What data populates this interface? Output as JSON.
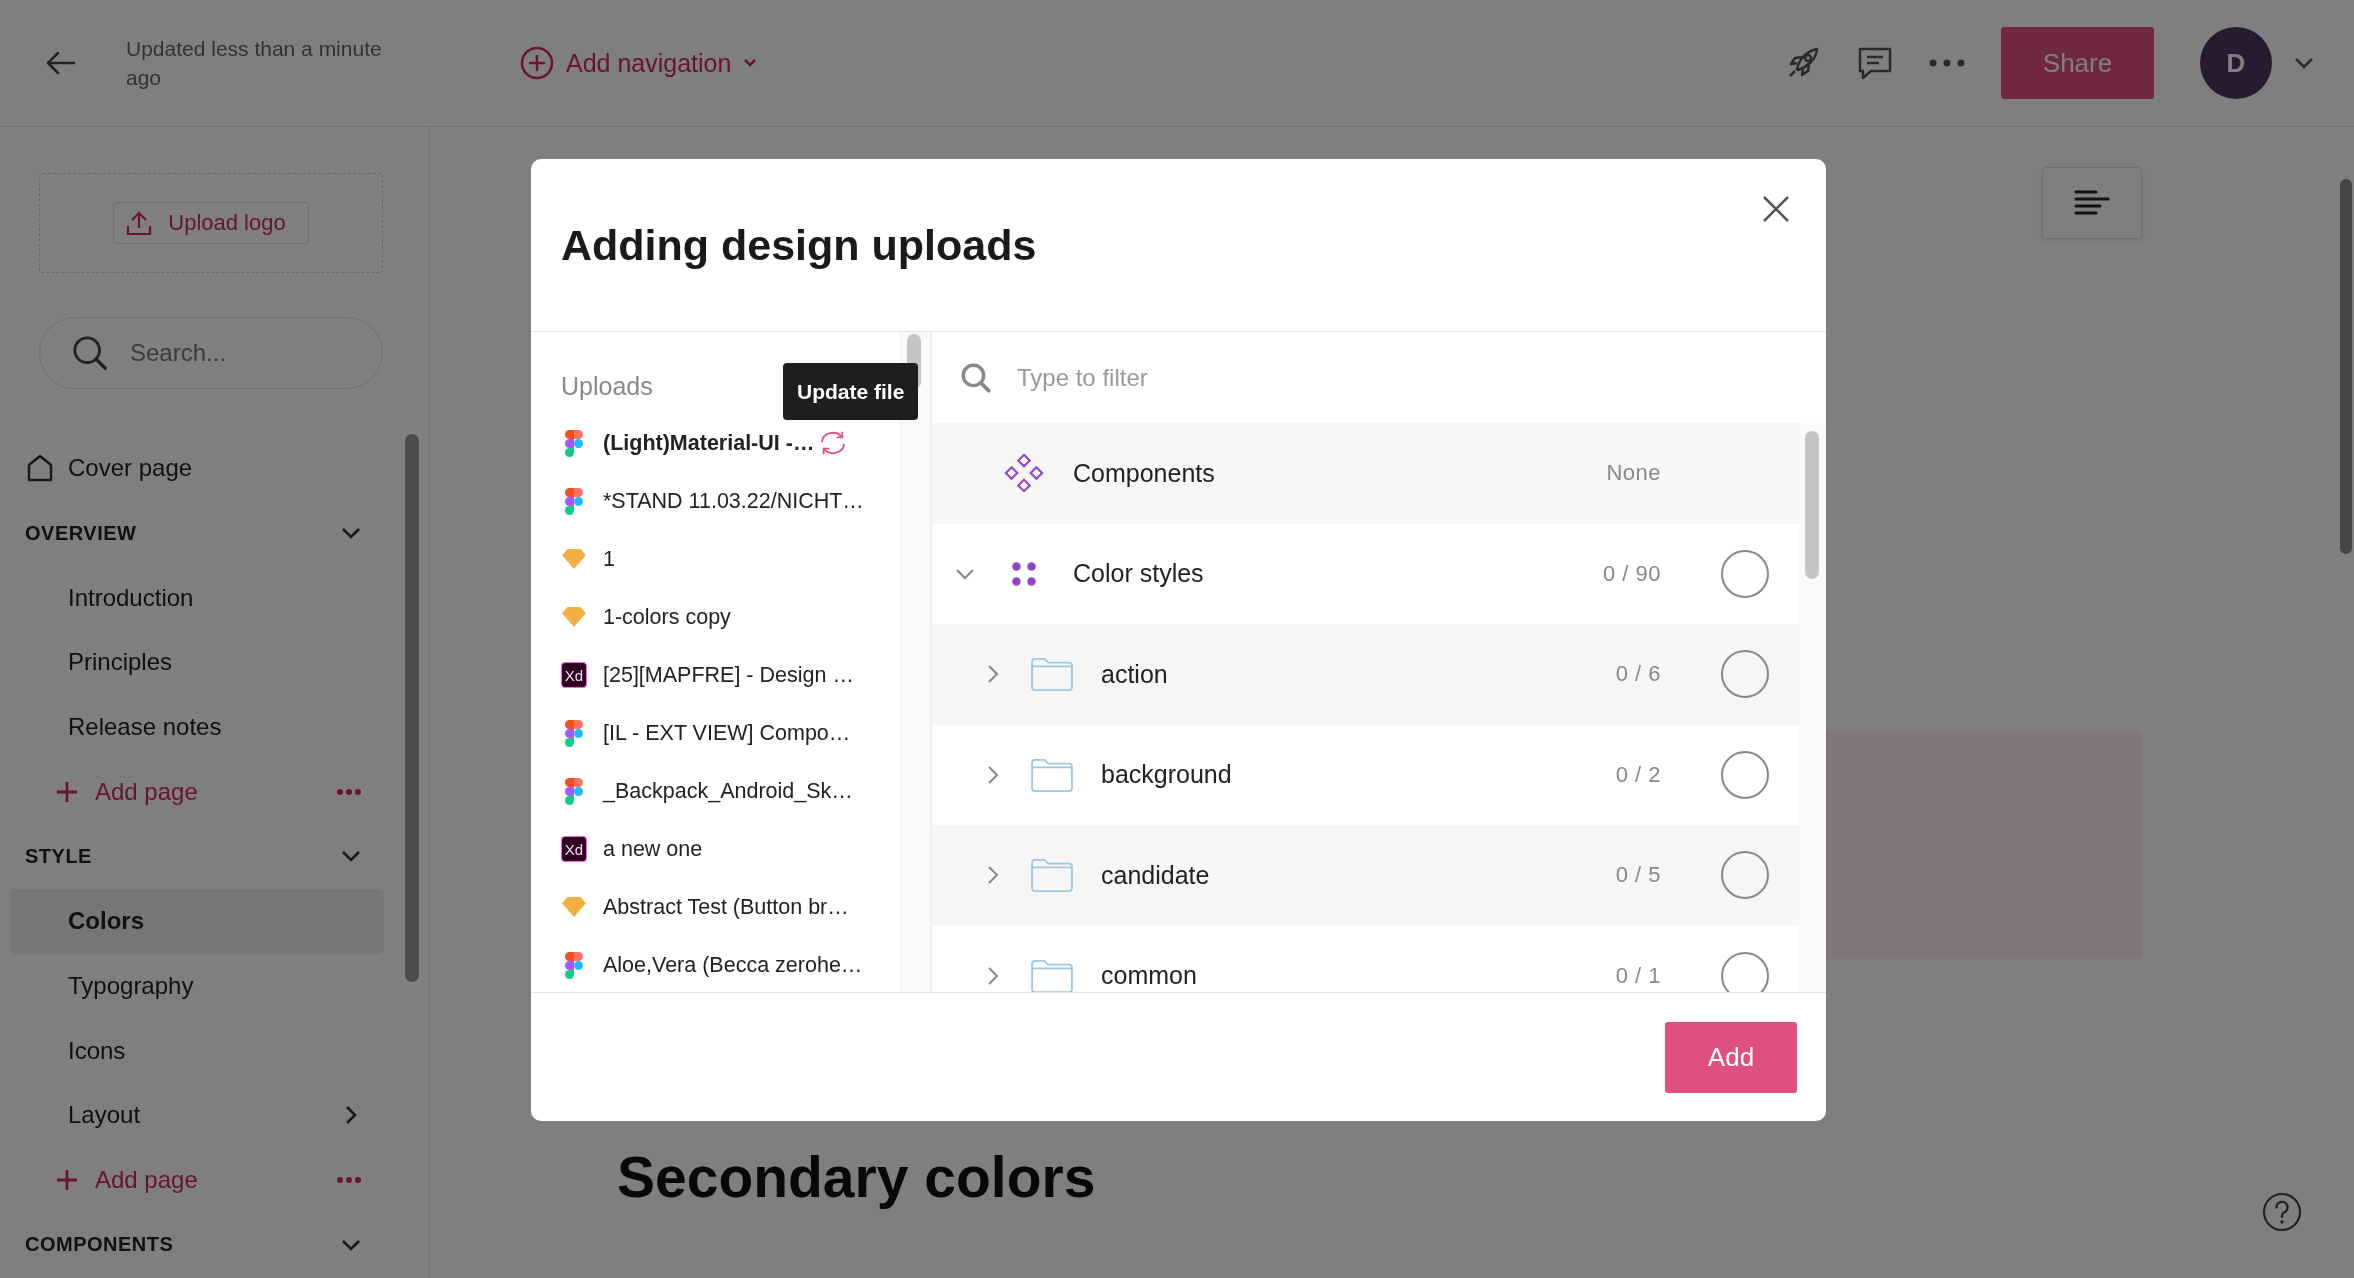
{
  "top_bar": {
    "status": "Updated less than a minute ago",
    "add_navigation": "Add navigation",
    "share": "Share",
    "avatar": "D"
  },
  "sidebar": {
    "upload_logo": "Upload logo",
    "search": {
      "placeholder": "Search..."
    },
    "cover_page": "Cover page",
    "sections": [
      {
        "title": "OVERVIEW",
        "expanded": true,
        "pages": [
          {
            "label": "Introduction",
            "selected": false,
            "expandable": false
          },
          {
            "label": "Principles",
            "selected": false,
            "expandable": false
          },
          {
            "label": "Release notes",
            "selected": false,
            "expandable": false
          }
        ],
        "add_page": "Add page"
      },
      {
        "title": "STYLE",
        "expanded": true,
        "pages": [
          {
            "label": "Colors",
            "selected": true,
            "expandable": false
          },
          {
            "label": "Typography",
            "selected": false,
            "expandable": false
          },
          {
            "label": "Icons",
            "selected": false,
            "expandable": false
          },
          {
            "label": "Layout",
            "selected": false,
            "expandable": true
          }
        ],
        "add_page": "Add page"
      },
      {
        "title": "COMPONENTS",
        "expanded": true
      }
    ]
  },
  "content": {
    "heading": "Secondary colors"
  },
  "modal": {
    "title": "Adding design uploads",
    "uploads_label": "Uploads",
    "tooltip": "Update file",
    "uploads": [
      {
        "name": "(Light)Material-UI -…",
        "kind": "figma",
        "selected": true,
        "updating": true
      },
      {
        "name": "*STAND 11.03.22/NICHT…",
        "kind": "figma",
        "selected": false,
        "updating": false
      },
      {
        "name": "1",
        "kind": "sketch",
        "selected": false,
        "updating": false
      },
      {
        "name": "1-colors copy",
        "kind": "sketch",
        "selected": false,
        "updating": false
      },
      {
        "name": "[25][MAPFRE] - Design …",
        "kind": "xd",
        "badge": "Xd",
        "selected": false,
        "updating": false
      },
      {
        "name": "[IL - EXT VIEW] Compo…",
        "kind": "figma",
        "selected": false,
        "updating": false
      },
      {
        "name": "_Backpack_Android_Sk…",
        "kind": "figma",
        "selected": false,
        "updating": false
      },
      {
        "name": "a new one",
        "kind": "xd",
        "badge": "Xd",
        "selected": false,
        "updating": false
      },
      {
        "name": "Abstract Test (Button br…",
        "kind": "sketch",
        "selected": false,
        "updating": false
      },
      {
        "name": "Aloe,Vera (Becca zerohe…",
        "kind": "figma",
        "selected": false,
        "updating": false
      }
    ],
    "filter": {
      "placeholder": "Type to filter"
    },
    "tree": [
      {
        "label": "Components",
        "kind": "components",
        "count": "None"
      },
      {
        "label": "Color styles",
        "kind": "color-styles",
        "count": "0 / 90",
        "expanded": true,
        "checked": false,
        "children": [
          {
            "label": "action",
            "kind": "folder",
            "count": "0 / 6",
            "expanded": false,
            "checked": false
          },
          {
            "label": "background",
            "kind": "folder",
            "count": "0 / 2",
            "expanded": false,
            "checked": false
          },
          {
            "label": "candidate",
            "kind": "folder",
            "count": "0 / 5",
            "expanded": false,
            "checked": false
          },
          {
            "label": "common",
            "kind": "folder",
            "count": "0 / 1",
            "expanded": false,
            "checked": false
          }
        ]
      }
    ],
    "add": "Add"
  }
}
